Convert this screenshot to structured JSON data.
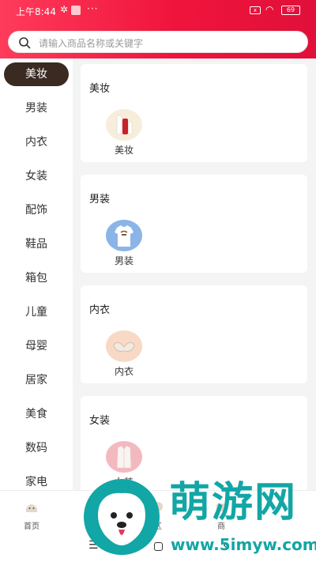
{
  "status_bar": {
    "time": "上午8:44",
    "dots": "···",
    "sim_label": "x",
    "battery": "69"
  },
  "search": {
    "placeholder": "请输入商品名称或关键字"
  },
  "sidebar": {
    "items": [
      {
        "label": "美妆",
        "active": true
      },
      {
        "label": "男装"
      },
      {
        "label": "内衣"
      },
      {
        "label": "女装"
      },
      {
        "label": "配饰"
      },
      {
        "label": "鞋品"
      },
      {
        "label": "箱包"
      },
      {
        "label": "儿童"
      },
      {
        "label": "母婴"
      },
      {
        "label": "居家"
      },
      {
        "label": "美食"
      },
      {
        "label": "数码"
      },
      {
        "label": "家电"
      }
    ]
  },
  "sections": [
    {
      "title": "美妆",
      "item": {
        "label": "美妆",
        "icon": "cosmetics-tube"
      }
    },
    {
      "title": "男装",
      "item": {
        "label": "男装",
        "icon": "mens-tshirt"
      }
    },
    {
      "title": "内衣",
      "item": {
        "label": "内衣",
        "icon": "bra"
      }
    },
    {
      "title": "女装",
      "item": {
        "label": "女装",
        "icon": "womens-shirt"
      }
    }
  ],
  "bottom_nav": {
    "items": [
      {
        "label": "首页",
        "icon": "home-icon"
      },
      {
        "label": "",
        "icon": ""
      },
      {
        "label": "区",
        "icon": "zone-icon"
      },
      {
        "label": "商",
        "icon": "shop-icon"
      },
      {
        "label": "",
        "icon": ""
      }
    ]
  },
  "watermark": {
    "title": "萌游网",
    "url": "www.5imyw.com"
  },
  "colors": {
    "brand": "#f0143c",
    "active_bg": "#3a2a22",
    "watermark": "#12a6a6"
  }
}
